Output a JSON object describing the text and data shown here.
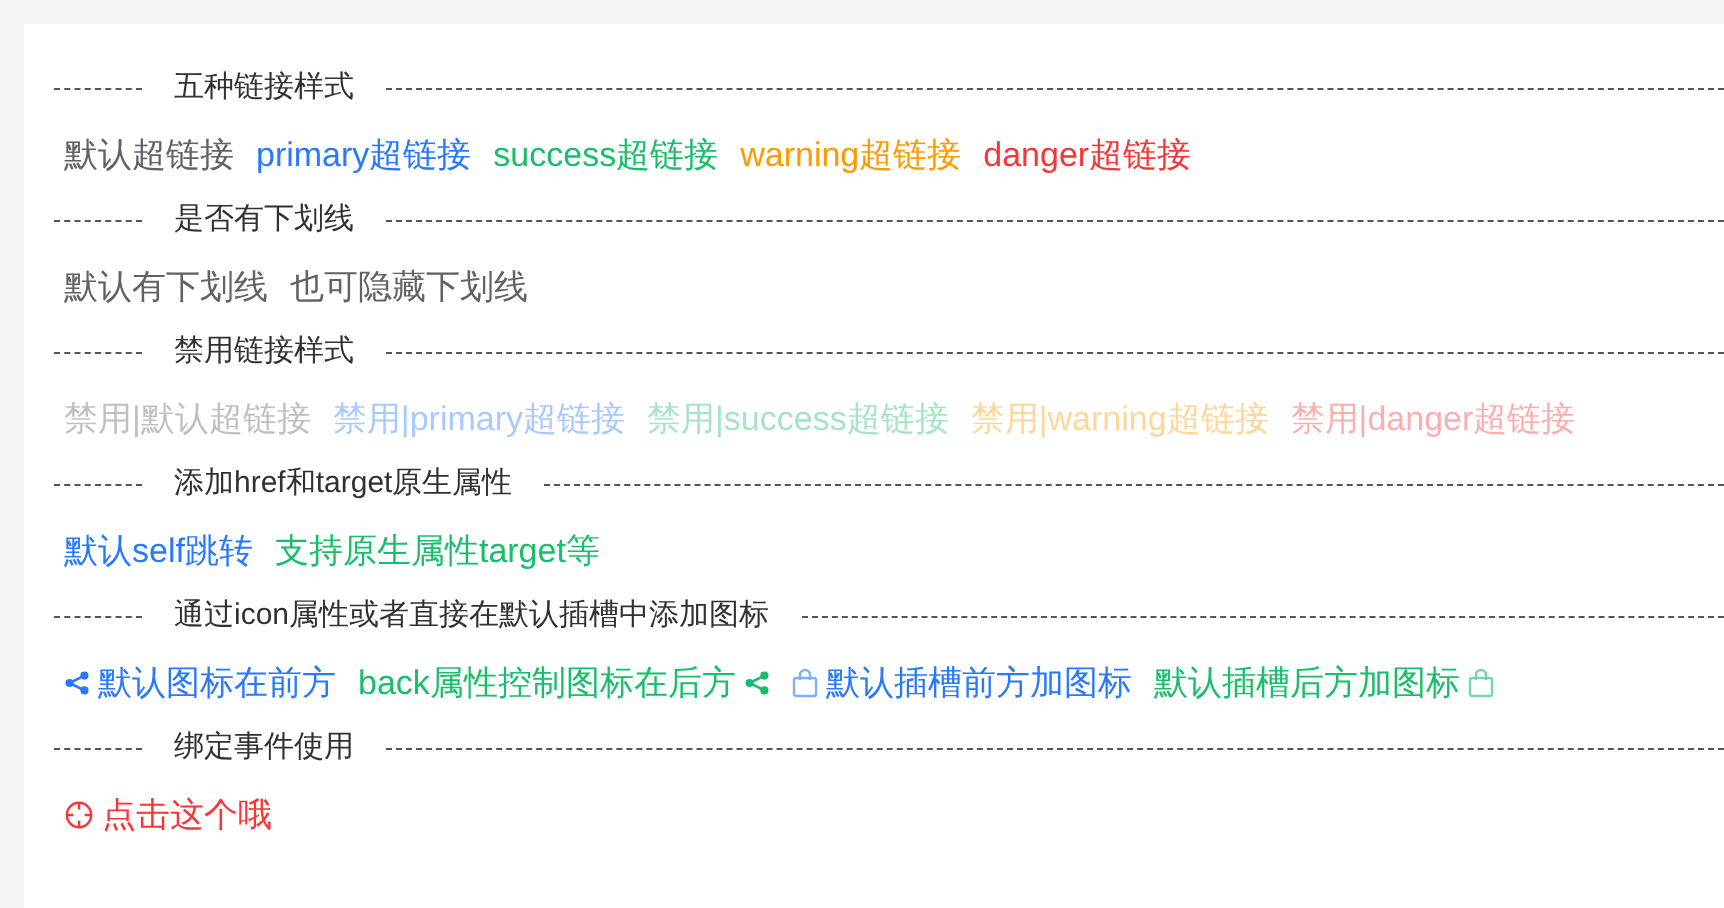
{
  "sections": [
    {
      "title": "五种链接样式",
      "links": [
        {
          "text": "默认超链接",
          "kind": "default",
          "disabled": false
        },
        {
          "text": "primary超链接",
          "kind": "primary",
          "disabled": false
        },
        {
          "text": "success超链接",
          "kind": "success",
          "disabled": false
        },
        {
          "text": "warning超链接",
          "kind": "warning",
          "disabled": false
        },
        {
          "text": "danger超链接",
          "kind": "danger",
          "disabled": false
        }
      ]
    },
    {
      "title": "是否有下划线",
      "links": [
        {
          "text": "默认有下划线",
          "kind": "default",
          "disabled": false
        },
        {
          "text": "也可隐藏下划线",
          "kind": "default",
          "disabled": false
        }
      ]
    },
    {
      "title": "禁用链接样式",
      "links": [
        {
          "text": "禁用|默认超链接",
          "kind": "default",
          "disabled": true
        },
        {
          "text": "禁用|primary超链接",
          "kind": "primary",
          "disabled": true
        },
        {
          "text": "禁用|success超链接",
          "kind": "success",
          "disabled": true
        },
        {
          "text": "禁用|warning超链接",
          "kind": "warning",
          "disabled": true
        },
        {
          "text": "禁用|danger超链接",
          "kind": "danger",
          "disabled": true
        }
      ]
    },
    {
      "title": "添加href和target原生属性",
      "links": [
        {
          "text": "默认self跳转",
          "kind": "primary",
          "disabled": false
        },
        {
          "text": "支持原生属性target等",
          "kind": "success",
          "disabled": false
        }
      ]
    },
    {
      "title": "通过icon属性或者直接在默认插槽中添加图标",
      "links": [
        {
          "text": "默认图标在前方",
          "kind": "primary",
          "disabled": false,
          "icon": {
            "kind": "share",
            "after": false
          }
        },
        {
          "text": "back属性控制图标在后方",
          "kind": "success",
          "disabled": false,
          "icon": {
            "kind": "share",
            "after": true
          }
        },
        {
          "text": "默认插槽前方加图标",
          "kind": "primary",
          "disabled": false,
          "icon": {
            "kind": "bag",
            "after": false
          }
        },
        {
          "text": "默认插槽后方加图标",
          "kind": "success",
          "disabled": false,
          "icon": {
            "kind": "bag",
            "after": true
          }
        }
      ]
    },
    {
      "title": "绑定事件使用",
      "links": [
        {
          "text": "点击这个哦",
          "kind": "danger",
          "disabled": false,
          "icon": {
            "kind": "target",
            "after": false
          }
        }
      ]
    }
  ]
}
